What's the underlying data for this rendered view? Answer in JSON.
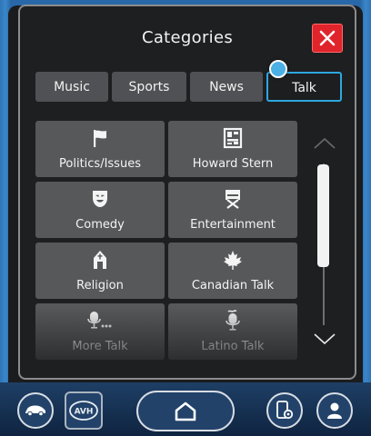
{
  "header": {
    "title": "Categories"
  },
  "tabs": [
    {
      "label": "Music",
      "active": false
    },
    {
      "label": "Sports",
      "active": false
    },
    {
      "label": "News",
      "active": false
    },
    {
      "label": "Talk",
      "active": true
    }
  ],
  "categories": [
    {
      "label": "Politics/Issues",
      "icon": "flag-icon"
    },
    {
      "label": "Howard Stern",
      "icon": "howard-stern-logo-icon"
    },
    {
      "label": "Comedy",
      "icon": "comedy-mask-icon"
    },
    {
      "label": "Entertainment",
      "icon": "director-chair-icon"
    },
    {
      "label": "Religion",
      "icon": "church-icon"
    },
    {
      "label": "Canadian Talk",
      "icon": "maple-leaf-icon"
    },
    {
      "label": "More Talk",
      "icon": "microphone-more-icon"
    },
    {
      "label": "Latino Talk",
      "icon": "microphone-tilde-icon"
    }
  ],
  "bottom_bar": {
    "avh_label": "AVH",
    "buttons": [
      "car-icon",
      "avh-icon",
      "home-icon",
      "phone-settings-icon",
      "user-icon"
    ]
  },
  "colors": {
    "accent": "#2ea7e0",
    "close": "#e0242b",
    "tile": "#565859",
    "panel": "#1e1f21"
  }
}
